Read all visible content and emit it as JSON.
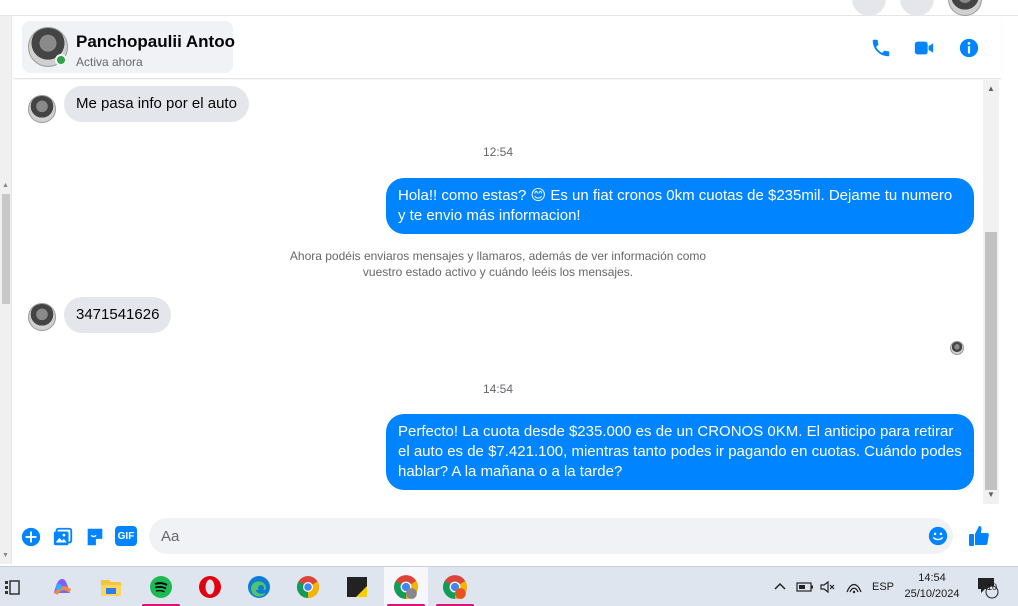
{
  "contact": {
    "name": "Panchopaulii Antoo",
    "status": "Activa ahora"
  },
  "header_actions": {
    "call_icon": "phone-icon",
    "video_icon": "video-camera-icon",
    "info_icon": "info-icon"
  },
  "messages": [
    {
      "direction": "in",
      "text": "Me pasa info por el auto"
    },
    {
      "type": "timestamp",
      "text": "12:54"
    },
    {
      "direction": "out",
      "text": "Hola!! como estas? 😊 Es un fiat cronos 0km cuotas de $235mil. Dejame tu numero y te envio más informacion!"
    },
    {
      "type": "system",
      "text": "Ahora podéis enviaros mensajes y llamaros, además de ver información como vuestro estado activo y cuándo leéis los mensajes."
    },
    {
      "direction": "in",
      "text": "3471541626"
    },
    {
      "type": "timestamp",
      "text": "14:54"
    },
    {
      "direction": "out",
      "text": "Perfecto! La cuota desde $235.000 es de un CRONOS 0KM. El anticipo para retirar el auto es de $7.421.100, mientras tanto podes ir pagando en cuotas. Cuándo podes hablar? A la mañana o a la tarde?"
    }
  ],
  "composer": {
    "placeholder": "Aa",
    "value": "",
    "icons": [
      "plus-icon",
      "image-icon",
      "sticker-icon",
      "gif-icon",
      "emoji-icon",
      "like-icon"
    ],
    "gif_label": "GIF"
  },
  "taskbar": {
    "apps": [
      "task-view-icon",
      "copilot-icon",
      "file-explorer-icon",
      "spotify-icon",
      "opera-icon",
      "edge-icon",
      "chrome-icon",
      "sticky-notes-icon",
      "chrome-profile-icon",
      "chrome-profile-icon"
    ],
    "language": "ESP",
    "time": "14:54",
    "date": "25/10/2024",
    "notification_count": "10"
  },
  "colors": {
    "accent": "#0084ff",
    "incoming_bubble": "#e4e6eb",
    "online": "#31a24c"
  }
}
